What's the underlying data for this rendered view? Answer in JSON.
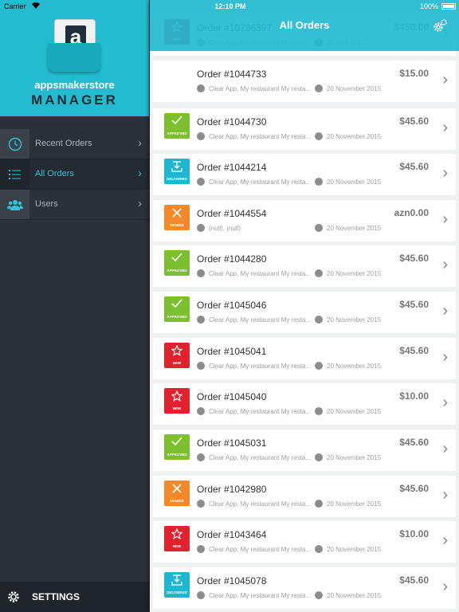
{
  "statusbar": {
    "carrier": "Carrier",
    "time": "12:10 PM",
    "battery": "100%"
  },
  "sidebar": {
    "brand_top": "appsmakerstore",
    "brand_bottom": "MANAGER",
    "logo_letter": "a",
    "items": [
      {
        "label": "Recent Orders",
        "icon": "clock-icon",
        "active": false
      },
      {
        "label": "All Orders",
        "icon": "list-icon",
        "active": true
      },
      {
        "label": "Users",
        "icon": "users-icon",
        "active": false
      }
    ],
    "settings_label": "SETTINGS"
  },
  "navbar": {
    "title": "All Orders"
  },
  "colors": {
    "accent": "#22bbd0",
    "approved": "#7cbf2f",
    "new": "#e0212e",
    "delivered": "#1fb6d2",
    "denied": "#f2892c"
  },
  "orders": [
    {
      "id": "Order #10736397",
      "price": "$450.00",
      "status": "NEW",
      "meta": "Clear App, My restaurant My resta...",
      "date": "28 April 2017"
    },
    {
      "id": "Order #1044733",
      "price": "$15.00",
      "status": "",
      "meta": "Clear App, My restaurant My resta...",
      "date": "20 November 2015"
    },
    {
      "id": "Order #1044730",
      "price": "$45.60",
      "status": "APPROVED",
      "meta": "Clear App, My restaurant My resta...",
      "date": "20 November 2015"
    },
    {
      "id": "Order #1044214",
      "price": "$45.60",
      "status": "DELIVERED",
      "meta": "Clear App, My restaurant My resta...",
      "date": "20 November 2015"
    },
    {
      "id": "Order #1044554",
      "price": "azn0.00",
      "status": "DENIED",
      "meta": "(null), (null)",
      "date": "20 November 2015"
    },
    {
      "id": "Order #1044280",
      "price": "$45.60",
      "status": "APPROVED",
      "meta": "Clear App, My restaurant My resta...",
      "date": "20 November 2015"
    },
    {
      "id": "Order #1045046",
      "price": "$45.60",
      "status": "APPROVED",
      "meta": "Clear App, My restaurant My resta...",
      "date": "20 November 2015"
    },
    {
      "id": "Order #1045041",
      "price": "$45.60",
      "status": "NEW",
      "meta": "Clear App, My restaurant My resta...",
      "date": "20 November 2015"
    },
    {
      "id": "Order #1045040",
      "price": "$10.00",
      "status": "NEW",
      "meta": "Clear App, My restaurant My resta...",
      "date": "20 November 2015"
    },
    {
      "id": "Order #1045031",
      "price": "$45.60",
      "status": "APPROVED",
      "meta": "Clear App, My restaurant My resta...",
      "date": "20 November 2015"
    },
    {
      "id": "Order #1042980",
      "price": "$45.60",
      "status": "DENIED",
      "meta": "Clear App, My restaurant My resta...",
      "date": "20 November 2015"
    },
    {
      "id": "Order #1043464",
      "price": "$10.00",
      "status": "NEW",
      "meta": "Clear App, My restaurant My resta...",
      "date": "20 November 2015"
    },
    {
      "id": "Order #1045078",
      "price": "$45.60",
      "status": "DELIVERED",
      "meta": "Clear App, My restaurant My resta...",
      "date": "20 November 2015"
    }
  ]
}
